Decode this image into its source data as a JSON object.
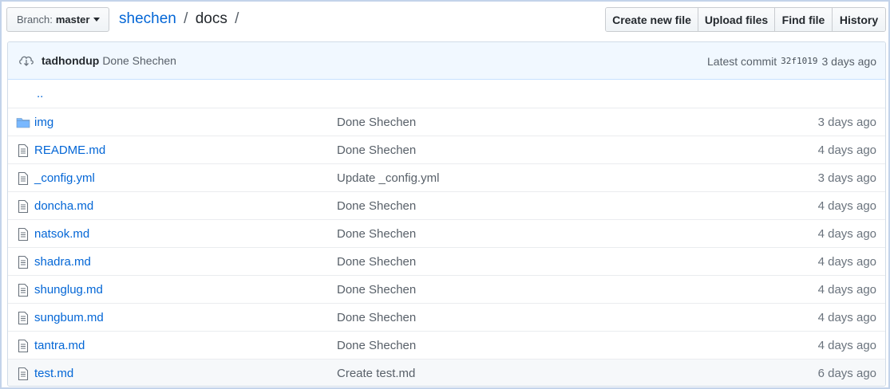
{
  "branch": {
    "label": "Branch:",
    "value": "master"
  },
  "breadcrumb": {
    "repo": "shechen",
    "sep1": "/",
    "folder": "docs",
    "sep2": "/"
  },
  "actions": {
    "create": "Create new file",
    "upload": "Upload files",
    "find": "Find file",
    "history": "History"
  },
  "commit": {
    "author": "tadhondup",
    "message": "Done Shechen",
    "latest_label": "Latest commit",
    "sha": "32f1019",
    "age": "3 days ago"
  },
  "parent_link": "..",
  "files": [
    {
      "type": "folder",
      "name": "img",
      "message": "Done Shechen",
      "age": "3 days ago"
    },
    {
      "type": "file",
      "name": "README.md",
      "message": "Done Shechen",
      "age": "4 days ago"
    },
    {
      "type": "file",
      "name": "_config.yml",
      "message": "Update _config.yml",
      "age": "3 days ago"
    },
    {
      "type": "file",
      "name": "doncha.md",
      "message": "Done Shechen",
      "age": "4 days ago"
    },
    {
      "type": "file",
      "name": "natsok.md",
      "message": "Done Shechen",
      "age": "4 days ago"
    },
    {
      "type": "file",
      "name": "shadra.md",
      "message": "Done Shechen",
      "age": "4 days ago"
    },
    {
      "type": "file",
      "name": "shunglug.md",
      "message": "Done Shechen",
      "age": "4 days ago"
    },
    {
      "type": "file",
      "name": "sungbum.md",
      "message": "Done Shechen",
      "age": "4 days ago"
    },
    {
      "type": "file",
      "name": "tantra.md",
      "message": "Done Shechen",
      "age": "4 days ago"
    },
    {
      "type": "file",
      "name": "test.md",
      "message": "Create test.md",
      "age": "6 days ago"
    }
  ],
  "colors": {
    "link": "#0366d6",
    "muted": "#586069",
    "commit_bg": "#f1f8ff"
  }
}
